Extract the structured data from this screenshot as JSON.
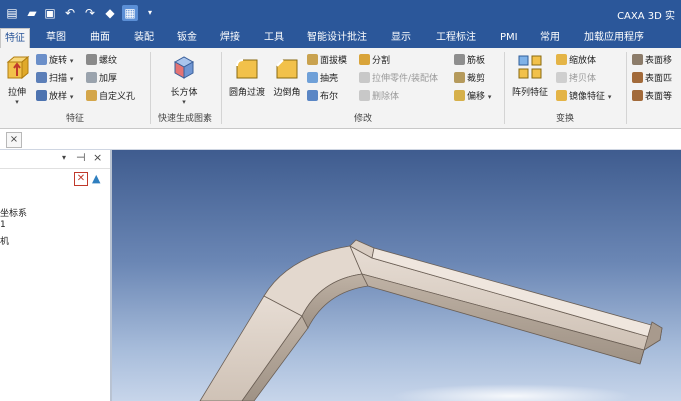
{
  "app": {
    "title": "CAXA 3D 实"
  },
  "quick_access": [
    {
      "name": "new-icon",
      "glyph": "▤"
    },
    {
      "name": "open-folder-icon",
      "glyph": "▰"
    },
    {
      "name": "save-icon",
      "glyph": "▣"
    },
    {
      "name": "undo-icon",
      "glyph": "↶"
    },
    {
      "name": "redo-icon",
      "glyph": "↷"
    },
    {
      "name": "render-icon",
      "glyph": "◆"
    },
    {
      "name": "measure-icon",
      "glyph": "▦"
    },
    {
      "name": "options-icon",
      "glyph": "▦"
    }
  ],
  "tabs": [
    "特征",
    "草图",
    "曲面",
    "装配",
    "钣金",
    "焊接",
    "工具",
    "智能设计批注",
    "显示",
    "工程标注",
    "PMI",
    "常用",
    "加载应用程序"
  ],
  "active_tab": "特征",
  "ribbon": {
    "groups": {
      "feature": "特征",
      "quick_generate": "快速生成图素",
      "modify": "修改",
      "transform": "变换"
    },
    "feature_group": {
      "extrude": "拉伸",
      "revolve": "旋转",
      "sweep": "扫描",
      "loft": "放样",
      "thread": "螺纹",
      "thicken": "加厚",
      "custom_hole": "自定义孔"
    },
    "quick_group": {
      "box": "长方体"
    },
    "modify_group": {
      "fillet": "圆角过渡",
      "chamfer": "边倒角",
      "face_draft": "面拔模",
      "shell": "抽壳",
      "boolean": "布尔",
      "split": "分割",
      "extrude_part": "拉伸零件/装配体",
      "delete_body": "删除体",
      "rib": "筋板",
      "trim": "裁剪",
      "offset": "偏移"
    },
    "transform_group": {
      "pattern": "阵列特征",
      "scale_body": "缩放体",
      "copy_body": "拷贝体",
      "mirror_feature": "镜像特征"
    },
    "surface_group": {
      "move_face": "表面移",
      "match_face": "表面匹",
      "equal_face": "表面等"
    }
  },
  "left_pane": {
    "tree_items": [
      "坐标系",
      "1",
      "机"
    ]
  },
  "colors": {
    "accent": "#2b579a",
    "ribbon_bg": "#f3f3f3",
    "part": "#cbbfb5"
  }
}
